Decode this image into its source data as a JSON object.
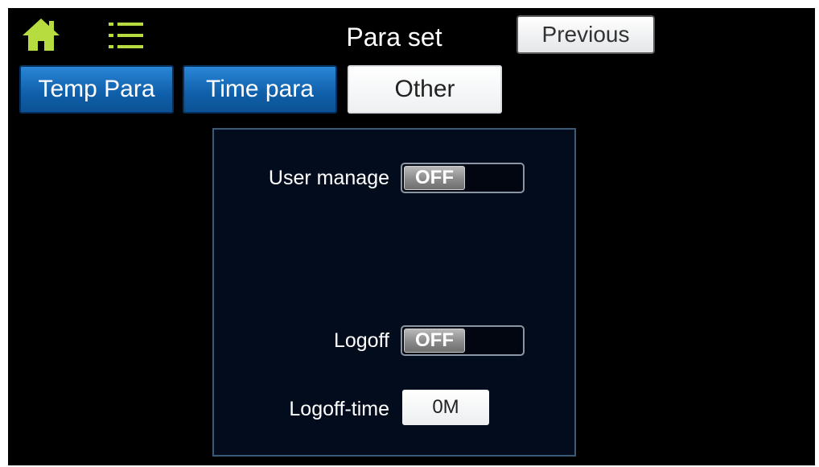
{
  "header": {
    "title": "Para set",
    "previous_label": "Previous",
    "home_icon": "home-icon",
    "menu_icon": "list-menu-icon"
  },
  "tabs": [
    {
      "label": "Temp Para",
      "active": false
    },
    {
      "label": "Time para",
      "active": false
    },
    {
      "label": "Other",
      "active": true
    }
  ],
  "settings": {
    "user_manage": {
      "label": "User manage",
      "state": "OFF"
    },
    "logoff": {
      "label": "Logoff",
      "state": "OFF"
    },
    "logoff_time": {
      "label": "Logoff-time",
      "value": "0M"
    }
  },
  "colors": {
    "background": "#000000",
    "icon_green": "#b7dc3f",
    "tab_blue": "#1466b4",
    "panel_border": "#3a5a78"
  }
}
